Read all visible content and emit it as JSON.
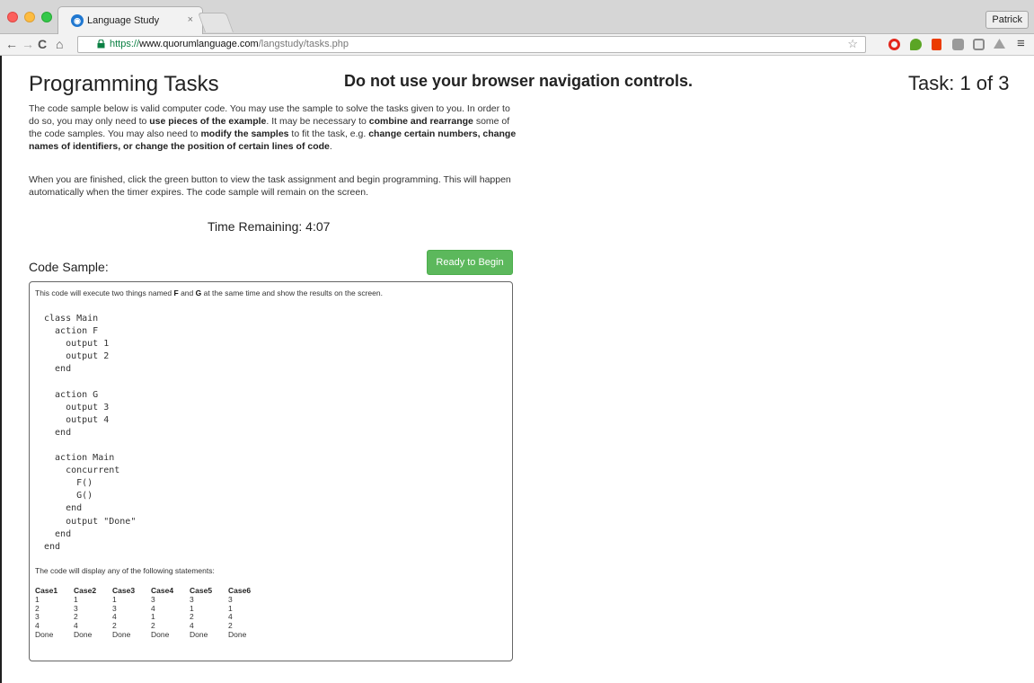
{
  "browser": {
    "tab_title": "Language Study",
    "tab_close": "×",
    "profile_name": "Patrick",
    "url_scheme": "https://",
    "url_host": "www.quorumlanguage.com",
    "url_path": "/langstudy/tasks.php",
    "icons": [
      "back-arrow-icon",
      "forward-arrow-icon",
      "reload-icon",
      "home-icon",
      "lock-icon",
      "star-icon",
      "opera-icon",
      "evernote-icon",
      "office-icon",
      "extension-icon",
      "extension-icon",
      "drive-icon",
      "menu-icon"
    ]
  },
  "header": {
    "title": "Programming Tasks",
    "warning": "Do not use your browser navigation controls.",
    "task_counter": "Task: 1 of 3"
  },
  "instructions": {
    "p1_a": "The code sample below is valid computer code. You may use the sample to solve the tasks given to you. In order to do so, you may only need to ",
    "p1_b": "use pieces of the example",
    "p1_c": ". It may be necessary to ",
    "p1_d": "combine and rearrange",
    "p1_e": " some of the code samples. You may also need to ",
    "p1_f": "modify the samples",
    "p1_g": " to fit the task, e.g. ",
    "p1_h": "change certain numbers, change names of identifiers, or change the position of certain lines of code",
    "p1_i": ".",
    "p2": "When you are finished, click the green button to view the task assignment and begin programming. This will happen automatically when the timer expires. The code sample will remain on the screen."
  },
  "timer": {
    "label": "Time Remaining: 4:07"
  },
  "code_sample": {
    "heading": "Code Sample:",
    "ready_button": "Ready to Begin",
    "intro_a": "This code will execute two things named ",
    "intro_f": "F",
    "intro_and": " and ",
    "intro_g": "G",
    "intro_b": " at the same time and show the results on the screen.",
    "code": "class Main\n  action F\n    output 1\n    output 2\n  end\n\n  action G\n    output 3\n    output 4\n  end\n\n  action Main\n    concurrent\n      F()\n      G()\n    end\n    output \"Done\"\n  end\nend",
    "outputs_intro": "The code will display any of the following statements:",
    "cases_headers": [
      "Case1",
      "Case2",
      "Case3",
      "Case4",
      "Case5",
      "Case6"
    ],
    "cases_rows": [
      [
        "1",
        "1",
        "1",
        "3",
        "3",
        "3"
      ],
      [
        "2",
        "3",
        "3",
        "4",
        "1",
        "1"
      ],
      [
        "3",
        "2",
        "4",
        "1",
        "2",
        "4"
      ],
      [
        "4",
        "4",
        "2",
        "2",
        "4",
        "2"
      ],
      [
        "Done",
        "Done",
        "Done",
        "Done",
        "Done",
        "Done"
      ]
    ]
  },
  "colors": {
    "ready_button": "#5cb85c",
    "url_secure": "#0b8043"
  }
}
